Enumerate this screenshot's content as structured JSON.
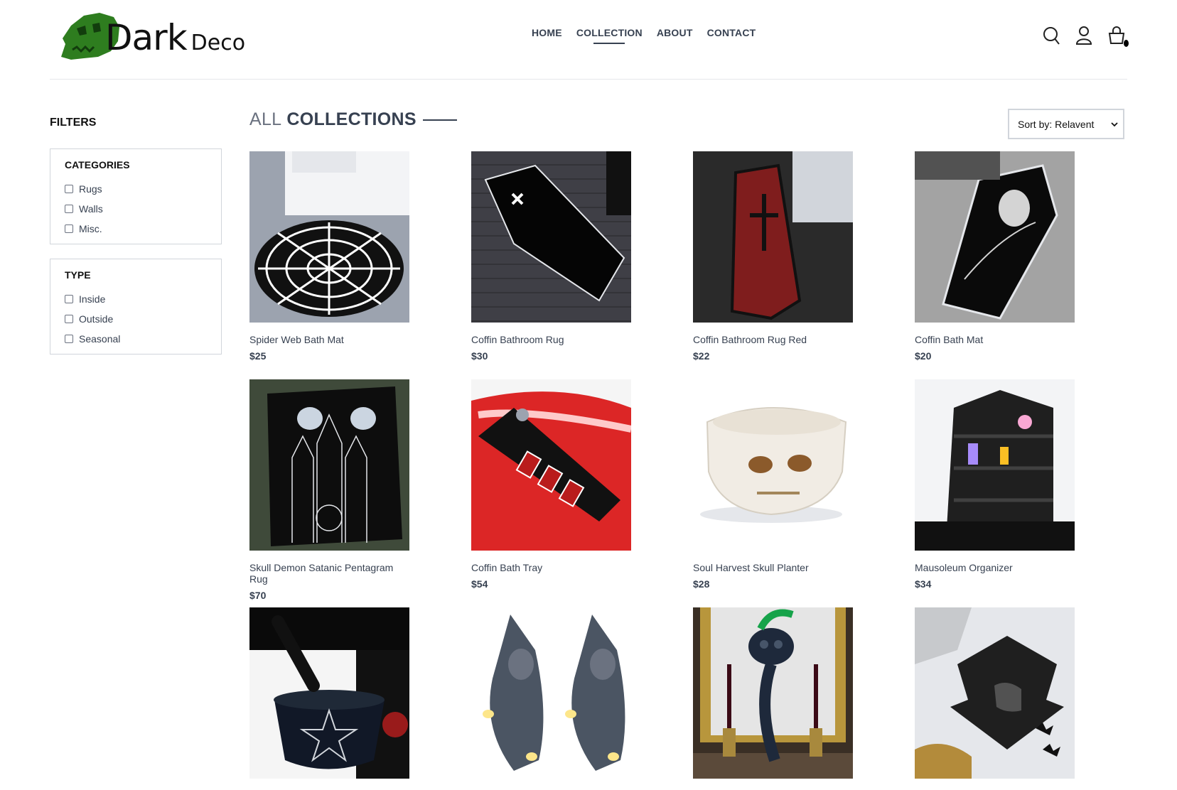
{
  "brand": {
    "name_dark": "Dark",
    "name_deco": "Deco",
    "logo_icon": "skull-logo",
    "logo_color": "#2e7d1f"
  },
  "nav": [
    {
      "label": "HOME"
    },
    {
      "label": "COLLECTION",
      "active": true
    },
    {
      "label": "ABOUT"
    },
    {
      "label": "CONTACT"
    }
  ],
  "header_icons": [
    "search-icon",
    "user-icon",
    "cart-icon"
  ],
  "filters": {
    "title": "FILTERS",
    "categories": {
      "heading": "CATEGORIES",
      "options": [
        "Rugs",
        "Walls",
        "Misc."
      ]
    },
    "type": {
      "heading": "TYPE",
      "options": [
        "Inside",
        "Outside",
        "Seasonal"
      ]
    }
  },
  "collection": {
    "title_light": "ALL",
    "title_bold": "COLLECTIONS"
  },
  "sort": {
    "selected": "Sort by: Relavent"
  },
  "products": [
    {
      "name": "Spider Web Bath Mat",
      "price": "$25"
    },
    {
      "name": "Coffin Bathroom Rug",
      "price": "$30"
    },
    {
      "name": "Coffin Bathroom Rug Red",
      "price": "$22"
    },
    {
      "name": "Coffin Bath Mat",
      "price": "$20"
    },
    {
      "name": "Skull Demon Satanic Pentagram Rug",
      "price": "$70"
    },
    {
      "name": "Coffin Bath Tray",
      "price": "$54"
    },
    {
      "name": "Soul Harvest Skull Planter",
      "price": "$28"
    },
    {
      "name": "Mausoleum Organizer",
      "price": "$34"
    },
    {
      "name": "",
      "price": ""
    },
    {
      "name": "",
      "price": ""
    },
    {
      "name": "",
      "price": ""
    },
    {
      "name": "",
      "price": ""
    }
  ]
}
